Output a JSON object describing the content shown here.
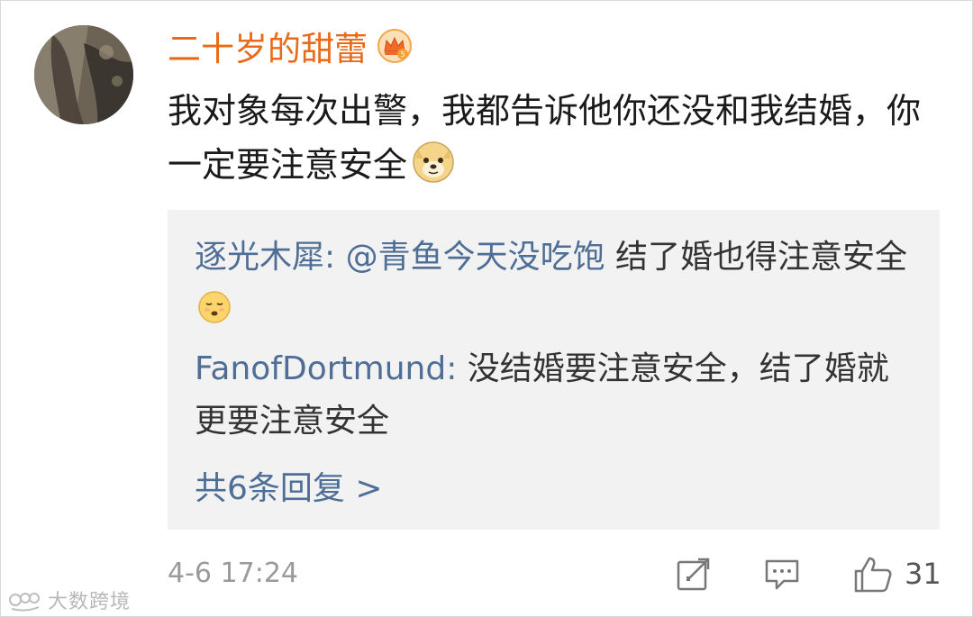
{
  "comment": {
    "username": "二十岁的甜蕾",
    "text": "我对象每次出警，我都告诉他你还没和我结婚，你一定要注意安全",
    "timestamp": "4-6 17:24",
    "like_count": "31"
  },
  "replies": [
    {
      "author": "逐光木犀",
      "separator": ": ",
      "mention": "@青鱼今天没吃饱",
      "text": " 结了婚也得注意安全"
    },
    {
      "author": "FanofDortmund",
      "separator": ": ",
      "mention": "",
      "text": "没结婚要注意安全，结了婚就更要注意安全"
    }
  ],
  "more_replies_label": "共6条回复 >",
  "watermark": "大数跨境",
  "icons": {
    "badge": "crown-badge-icon",
    "emoji_comment": "doge-emoji-icon",
    "emoji_reply": "sad-face-emoji-icon",
    "repost": "repost-icon",
    "comment": "comment-icon",
    "like": "thumbs-up-icon"
  },
  "colors": {
    "username": "#e96b1a",
    "link": "#4f6e96",
    "reply_bg": "#f2f2f2",
    "meta": "#9a9a9a"
  }
}
